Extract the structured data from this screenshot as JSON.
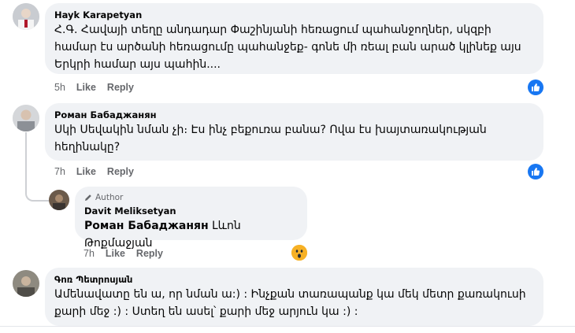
{
  "comments": [
    {
      "author": "Hayk Karapetyan",
      "text": "Հ.Գ. Հավայի տեղը անդադար Փաշինյանի հեռացում պահանջողներ, սկզբի համար էս արծանի հեռացումը պահանջեք- գոնե մի ռեալ բան արած կլինեք այս Երկրի համար այս պահին....",
      "time": "5h",
      "like": "Like",
      "reply": "Reply"
    },
    {
      "author": "Роман Бабаджанян",
      "text": "Սկի Սեվակին նման չի։ Էս ինչ բեքուռա բանա? Ովա էս խայտառակության հեղինակը?",
      "time": "7h",
      "like": "Like",
      "reply": "Reply"
    },
    {
      "badge": "Author",
      "author": "Davit Meliksetyan",
      "mention": "Роман Бабаджанян",
      "text": "Լևոն Թոքմաջյան",
      "time": "7h",
      "like": "Like",
      "reply": "Reply"
    },
    {
      "author": "Գոռ Պետրոսյան",
      "text": "Ամենավատը են ա, որ նման ա:) : Ինչքան տառապանք կա մեկ մետր քառակուսի քարի մեջ :) : Ստեղ են ասել՝ քարի մեջ արյուն կա :) :",
      "time": "",
      "like": "",
      "reply": ""
    }
  ],
  "icons": {
    "like_reaction": "thumbs-up-icon",
    "wow_reaction": "wow-face-icon",
    "author_badge": "pencil-icon"
  },
  "colors": {
    "bubble": "#f0f2f5",
    "like_blue": "#1877f2",
    "meta_gray": "#65676b"
  }
}
